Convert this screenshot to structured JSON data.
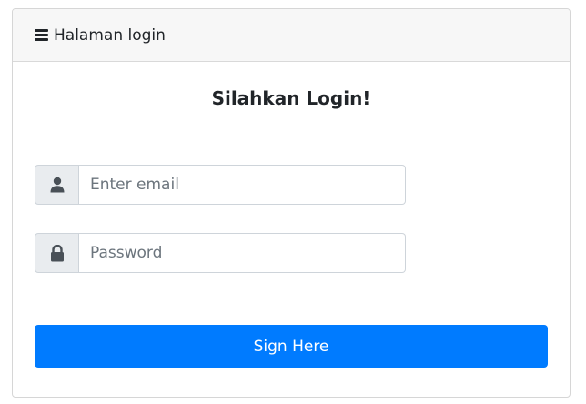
{
  "header": {
    "icon": "menu-icon",
    "title": "Halaman login"
  },
  "form": {
    "heading": "Silahkan Login!",
    "email": {
      "icon": "user-icon",
      "placeholder": "Enter email",
      "value": ""
    },
    "password": {
      "icon": "lock-icon",
      "placeholder": "Password",
      "value": ""
    },
    "submit_label": "Sign Here"
  },
  "colors": {
    "primary": "#007bff",
    "addon_bg": "#e9ecef",
    "header_bg": "#f7f7f7"
  }
}
